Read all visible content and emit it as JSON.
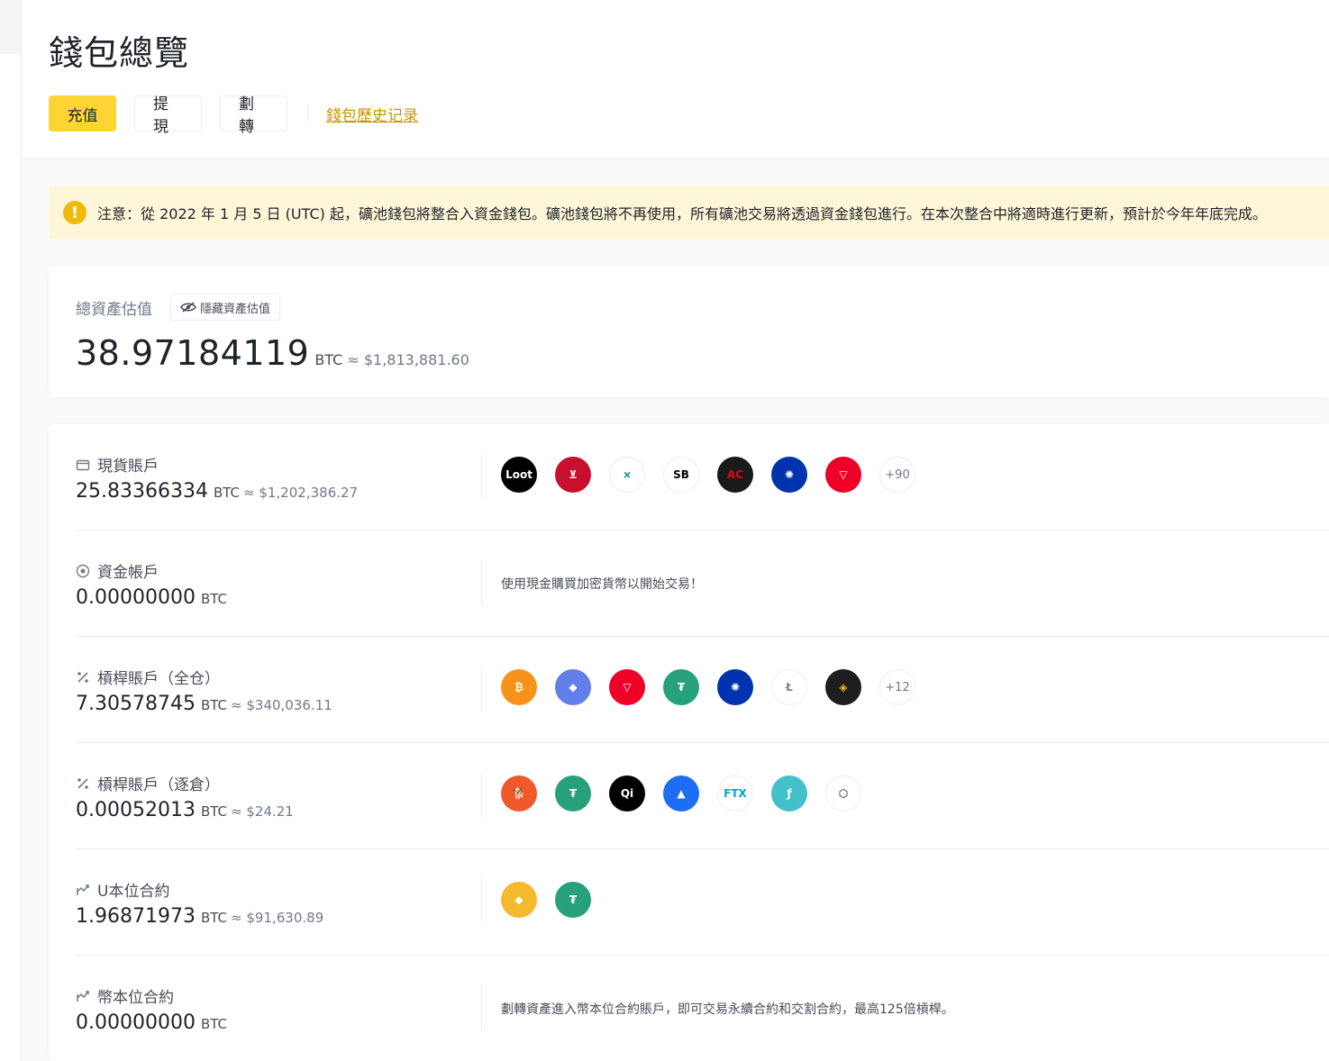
{
  "page": {
    "title": "錢包總覽",
    "actions": {
      "deposit": "充值",
      "withdraw": "提現",
      "transfer": "劃轉",
      "history": "錢包歷史记录"
    }
  },
  "notice": {
    "text": "注意：從 2022 年 1 月 5 日 (UTC) 起，礦池錢包將整合入資金錢包。礦池錢包將不再使用，所有礦池交易將透過資金錢包進行。在本次整合中將適時進行更新，預計於今年年底完成。"
  },
  "total": {
    "label": "總資產估值",
    "hide_label": "隱藏資產估值",
    "value": "38.97184119",
    "unit": "BTC",
    "fiat": "≈ $1,813,881.60"
  },
  "accounts": [
    {
      "icon": "wallet-icon",
      "name": "現貨賬戶",
      "value": "25.83366334",
      "unit": "BTC",
      "fiat": "≈ $1,202,386.27",
      "coins": [
        {
          "icon": "loot-coin-icon",
          "text": "Loot",
          "bg": "#000000",
          "fg": "#ffffff"
        },
        {
          "icon": "juventus-coin-icon",
          "text": "⊻",
          "bg": "#c8102e",
          "fg": "#ffffff"
        },
        {
          "icon": "holo-coin-icon",
          "text": "⨯",
          "bg": "#ffffff",
          "fg": "#00838d"
        },
        {
          "icon": "og-coin-icon",
          "text": "SB",
          "bg": "#ffffff",
          "fg": "#000000"
        },
        {
          "icon": "acm-coin-icon",
          "text": "AC",
          "bg": "#1a1a1a",
          "fg": "#e30613"
        },
        {
          "icon": "cardano-coin-icon",
          "text": "✺",
          "bg": "#0033ad",
          "fg": "#ffffff"
        },
        {
          "icon": "tron-coin-icon",
          "text": "▽",
          "bg": "#ef0027",
          "fg": "#ffffff"
        }
      ],
      "more": "+90"
    },
    {
      "icon": "target-icon",
      "name": "資金帳戶",
      "value": "0.00000000",
      "unit": "BTC",
      "fiat": "",
      "hint": "使用現金購買加密貨幣以開始交易！"
    },
    {
      "icon": "margin-icon",
      "name": "槓桿賬戶（全仓）",
      "value": "7.30578745",
      "unit": "BTC",
      "fiat": "≈ $340,036.11",
      "coins": [
        {
          "icon": "bitcoin-coin-icon",
          "text": "₿",
          "bg": "#f7931a",
          "fg": "#ffffff"
        },
        {
          "icon": "ethereum-coin-icon",
          "text": "◆",
          "bg": "#627eea",
          "fg": "#ffffff"
        },
        {
          "icon": "tron-coin-icon",
          "text": "▽",
          "bg": "#ef0027",
          "fg": "#ffffff"
        },
        {
          "icon": "tether-coin-icon",
          "text": "₮",
          "bg": "#26a17b",
          "fg": "#ffffff"
        },
        {
          "icon": "cardano-coin-icon",
          "text": "✺",
          "bg": "#0033ad",
          "fg": "#ffffff"
        },
        {
          "icon": "litecoin-coin-icon",
          "text": "Ł",
          "bg": "#ffffff",
          "fg": "#838383"
        },
        {
          "icon": "busd-coin-icon",
          "text": "◈",
          "bg": "#1e1e1e",
          "fg": "#f0b90b"
        }
      ],
      "more": "+12"
    },
    {
      "icon": "margin-icon",
      "name": "槓桿賬戶（逐倉）",
      "value": "0.00052013",
      "unit": "BTC",
      "fiat": "≈ $24.21",
      "coins": [
        {
          "icon": "shiba-coin-icon",
          "text": "🐕",
          "bg": "#f0592a",
          "fg": "#ffffff"
        },
        {
          "icon": "tether-coin-icon",
          "text": "₮",
          "bg": "#26a17b",
          "fg": "#ffffff"
        },
        {
          "icon": "qi-coin-icon",
          "text": "Qi",
          "bg": "#000000",
          "fg": "#ffffff"
        },
        {
          "icon": "waves-coin-icon",
          "text": "▲",
          "bg": "#1d6ef2",
          "fg": "#ffffff"
        },
        {
          "icon": "ftx-coin-icon",
          "text": "FTX",
          "bg": "#ffffff",
          "fg": "#02a6c2"
        },
        {
          "icon": "filecoin-coin-icon",
          "text": "ƒ",
          "bg": "#42c1ca",
          "fg": "#ffffff"
        },
        {
          "icon": "cube-coin-icon",
          "text": "⬡",
          "bg": "#ffffff",
          "fg": "#000000"
        }
      ],
      "more": ""
    },
    {
      "icon": "futures-icon",
      "name": "U本位合約",
      "value": "1.96871973",
      "unit": "BTC",
      "fiat": "≈ $91,630.89",
      "coins": [
        {
          "icon": "bnb-coin-icon",
          "text": "◆",
          "bg": "#f3ba2f",
          "fg": "#ffffff"
        },
        {
          "icon": "tether-coin-icon",
          "text": "₮",
          "bg": "#26a17b",
          "fg": "#ffffff"
        }
      ],
      "more": ""
    },
    {
      "icon": "futures-icon",
      "name": "幣本位合約",
      "value": "0.00000000",
      "unit": "BTC",
      "fiat": "",
      "hint": "劃轉資產進入幣本位合約賬戶，即可交易永續合約和交割合約，最高125倍槓桿。"
    }
  ]
}
